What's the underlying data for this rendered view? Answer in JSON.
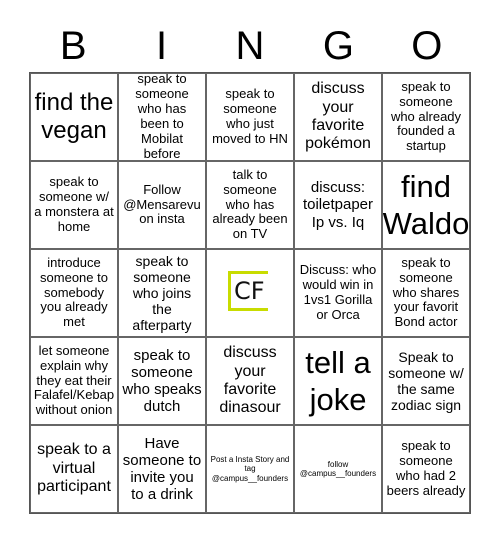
{
  "header": {
    "letters": [
      "B",
      "I",
      "N",
      "G",
      "O"
    ]
  },
  "colors": {
    "logo_accent": "#c8dc00",
    "border": "#666666"
  },
  "cells": [
    {
      "text": "find the vegan"
    },
    {
      "text": "speak to someone who has been to Mobilat before"
    },
    {
      "text": "speak to someone who just moved to HN"
    },
    {
      "text": "discuss your favorite pokémon"
    },
    {
      "text": "speak to someone who already founded a startup"
    },
    {
      "text": "speak to someone w/ a monstera at home"
    },
    {
      "text": "Follow @Mensarevu on insta"
    },
    {
      "text": "talk to someone who has already been on TV"
    },
    {
      "text": "discuss: toiletpaper Ip vs. Iq"
    },
    {
      "text": "find Waldo"
    },
    {
      "text": "introduce someone to somebody you already met"
    },
    {
      "text": "speak to someone who joins the afterparty"
    },
    {
      "text": "CF",
      "free_space": true,
      "icon": "campus-founders-logo"
    },
    {
      "text": "Discuss: who would win in 1vs1 Gorilla or Orca"
    },
    {
      "text": "speak to someone who shares your favorit Bond actor"
    },
    {
      "text": "let someone explain why they eat their Falafel/Kebap without onion"
    },
    {
      "text": "speak to someone who speaks dutch"
    },
    {
      "text": "discuss your favorite dinasour"
    },
    {
      "text": "tell a joke"
    },
    {
      "text": "Speak to someone w/ the same zodiac sign"
    },
    {
      "text": "speak to a virtual participant"
    },
    {
      "text": "Have someone to invite you to a drink"
    },
    {
      "text": "Post a Insta Story and tag @campus__founders"
    },
    {
      "text": "follow @campus__founders"
    },
    {
      "text": "speak to someone who had 2 beers already"
    }
  ]
}
